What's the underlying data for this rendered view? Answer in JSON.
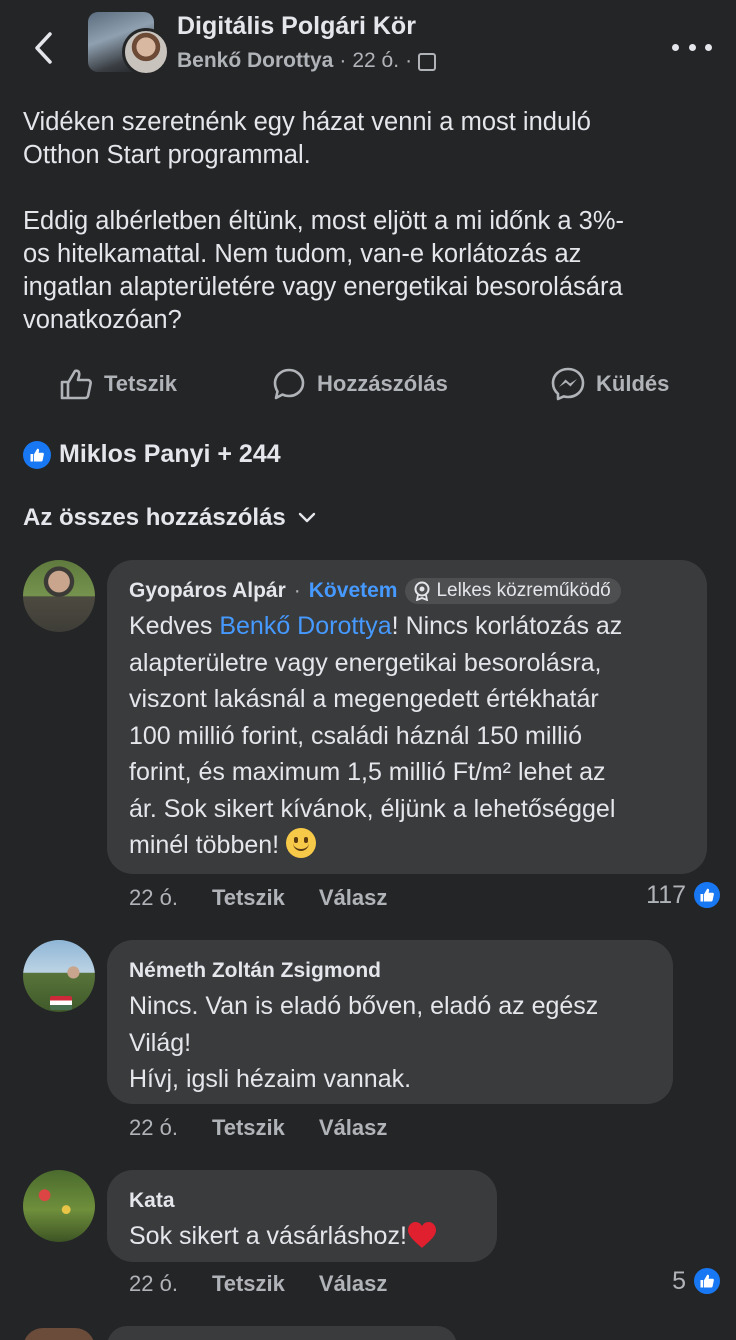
{
  "header": {
    "group_name": "Digitális Polgári Kör",
    "author": "Benkő Dorottya",
    "sep1": "·",
    "time": "22 ó.",
    "sep2": "·"
  },
  "post": {
    "paragraphs": [
      "Vidéken szeretnénk egy házat venni a most induló\nOtthon Start programmal.",
      "Eddig albérletben éltünk, most eljött a mi időnk a 3%-\nos hitelkamattal. Nem tudom, van-e korlátozás az\ningatlan alapterületére vagy energetikai besorolására\nvonatkozóan?"
    ]
  },
  "actions": {
    "like": "Tetszik",
    "comment": "Hozzászólás",
    "send": "Küldés"
  },
  "reactions": {
    "summary": "Miklos Panyi + 244"
  },
  "comments_filter": {
    "label": "Az összes hozzászólás"
  },
  "comments": [
    {
      "author": "Gyopáros Alpár",
      "sep": "·",
      "follow": "Követem",
      "badge": "Lelkes közreműködő",
      "text_before": "Kedves ",
      "mention": "Benkő Dorottya",
      "text_after": "! Nincs korlátozás az\nalapterületre vagy energetikai besorolásra,\nviszont lakásnál a megengedett értékhatár\n100 millió forint, családi háznál 150 millió\nforint, és maximum 1,5 millió Ft/m² lehet az\nár. Sok sikert kívánok, éljünk a lehetőséggel\nminél többen! ",
      "time": "22 ó.",
      "like": "Tetszik",
      "reply": "Válasz",
      "reaction_count": "117"
    },
    {
      "author": "Németh Zoltán Zsigmond",
      "text": "Nincs. Van is eladó bőven, eladó az egész\nVilág!\nHívj, igsli hézaim vannak.",
      "time": "22 ó.",
      "like": "Tetszik",
      "reply": "Válasz"
    },
    {
      "author": "Kata",
      "text": "Sok sikert a vásárláshoz!",
      "time": "22 ó.",
      "like": "Tetszik",
      "reply": "Válasz",
      "reaction_count": "5"
    }
  ],
  "colors": {
    "background": "#242526",
    "bubble": "#3a3b3c",
    "link_blue": "#4599ff",
    "like_blue": "#1877f2",
    "secondary_text": "#b0b3b8"
  },
  "icons": [
    "back-arrow-icon",
    "group-icon",
    "more-icon",
    "thumbs-up-icon",
    "comment-icon",
    "messenger-icon",
    "chevron-down-icon",
    "contributor-badge-icon",
    "smile-emoji-icon",
    "heart-emoji-icon"
  ]
}
